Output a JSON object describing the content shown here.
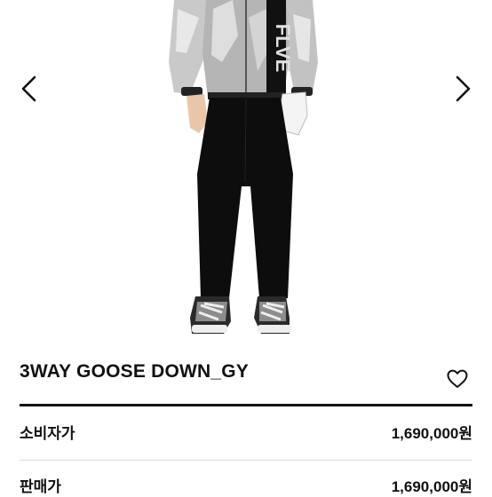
{
  "product": {
    "name": "3WAY GOOSE DOWN_GY"
  },
  "prices": [
    {
      "label": "소비자가",
      "value": "1,690,000원"
    },
    {
      "label": "판매가",
      "value": "1,690,000원"
    }
  ],
  "icons": {
    "prev": "chevron-left-icon",
    "next": "chevron-right-icon",
    "wishlist": "heart-icon"
  },
  "jacket_print": "FLVE",
  "colors": {
    "text": "#111111",
    "divider": "#111111",
    "jacket": "#bdbdbd",
    "pants": "#0d0d0d"
  }
}
